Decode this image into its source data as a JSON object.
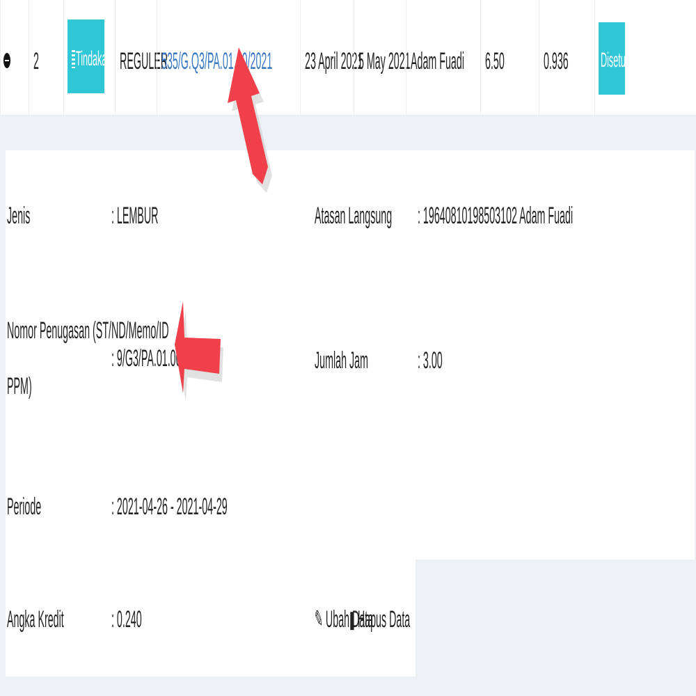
{
  "row": {
    "expand_icon": "minus-circle-icon",
    "number": "2",
    "action_button": {
      "label": "Tindakan",
      "icon": "list-icon",
      "caret": "▾"
    },
    "type": "REGULER",
    "document_link": "535/G.Q3/PA.01.00/2021",
    "date_start": "23 April 2021",
    "date_end": "5 May 2021",
    "person": "Adam Fuadi",
    "hours": "6.50",
    "credit": "0.936",
    "status_badge": "Disetujui"
  },
  "details": {
    "jenis_label": "Jenis",
    "jenis_value": ": LEMBUR",
    "atasan_label": "Atasan Langsung",
    "atasan_value": ": 19640810198503102 Adam Fuadi",
    "nomor_label_line1": "Nomor Penugasan (ST/ND/Memo/ID",
    "nomor_label_line2": "PPM)",
    "nomor_value": ": 9/G3/PA.01.00/2021",
    "jumlah_label": "Jumlah Jam",
    "jumlah_value": ": 3.00",
    "periode_label": "Periode",
    "periode_value": ": 2021-04-26 - 2021-04-29",
    "angka_label": "Angka Kredit",
    "angka_value": ": 0.240",
    "edit_link": "Ubah Data",
    "delete_link": "Hapus Data"
  },
  "colors": {
    "accent_teal": "#2fc6d6",
    "link_blue": "#3a78c2",
    "arrow_red": "#f2404b"
  }
}
